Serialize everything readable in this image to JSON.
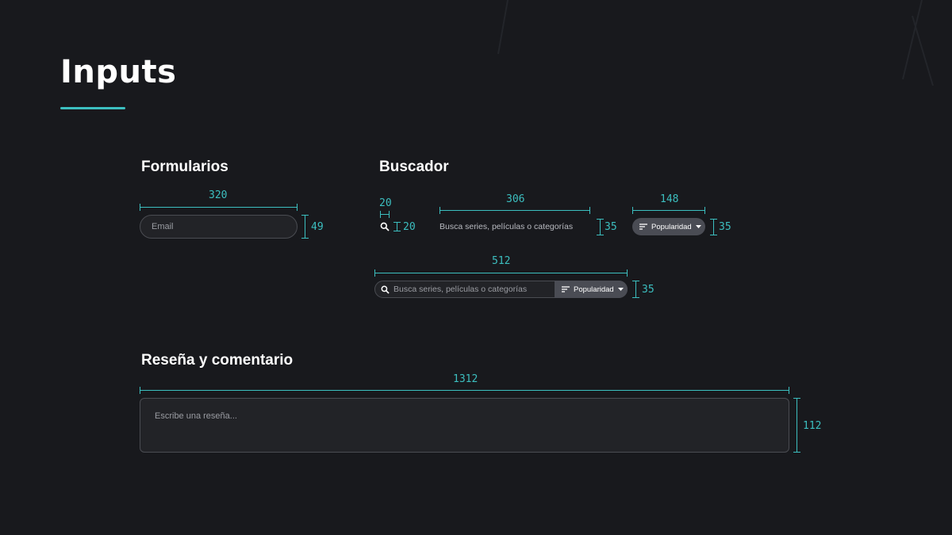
{
  "page": {
    "title": "Inputs"
  },
  "sections": {
    "forms": {
      "title": "Formularios"
    },
    "search": {
      "title": "Buscador"
    },
    "review": {
      "title": "Reseña y comentario"
    }
  },
  "email_input": {
    "placeholder": "Email",
    "width_label": "320",
    "height_label": "49"
  },
  "search_icon_spec": {
    "width_label": "20",
    "height_label": "20"
  },
  "search_field_spec": {
    "placeholder": "Busca series, películas o categorías",
    "width_label": "306",
    "height_label": "35"
  },
  "sort_button_spec": {
    "label": "Popularidad",
    "width_label": "148",
    "height_label": "35"
  },
  "search_bar": {
    "placeholder": "Busca series, películas o categorías",
    "sort_label": "Popularidad",
    "width_label": "512",
    "height_label": "35"
  },
  "review_input": {
    "placeholder": "Escribe una reseña...",
    "width_label": "1312",
    "height_label": "112"
  },
  "colors": {
    "background": "#18191d",
    "accent": "#3cbfc0",
    "field": "#222327",
    "button": "#4a4c54"
  }
}
